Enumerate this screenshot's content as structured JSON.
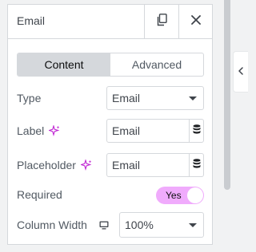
{
  "panel": {
    "title": "Email",
    "copy_icon": "copy-icon",
    "close_icon": "close-icon"
  },
  "tabs": [
    {
      "label": "Content",
      "active": true
    },
    {
      "label": "Advanced",
      "active": false
    }
  ],
  "fields": {
    "type": {
      "label": "Type",
      "value": "Email"
    },
    "label": {
      "label": "Label",
      "value": "Email",
      "ai_icon": "ai-sparkle-icon",
      "dynamic_icon": "database-icon"
    },
    "placeholder": {
      "label": "Placeholder",
      "value": "Email",
      "ai_icon": "ai-sparkle-icon",
      "dynamic_icon": "database-icon"
    },
    "required": {
      "label": "Required",
      "toggle_text": "Yes",
      "on": true
    },
    "column_width": {
      "label": "Column Width",
      "device_icon": "desktop-icon",
      "value": "100%"
    }
  },
  "colors": {
    "accent_toggle": "#f0abfc",
    "ai_sparkle": "#c026d3",
    "border": "#d5d8dc",
    "active_tab": "#d5d8dc"
  }
}
